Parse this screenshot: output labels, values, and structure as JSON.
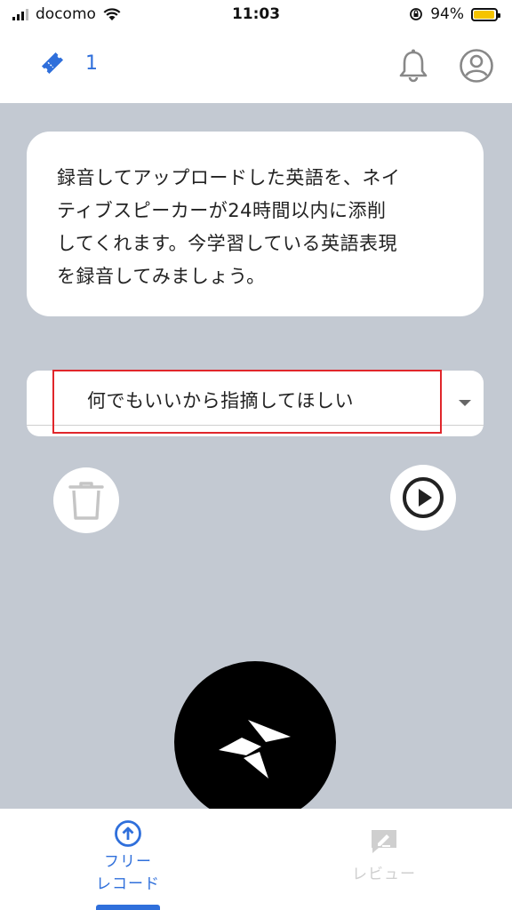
{
  "status_bar": {
    "carrier": "docomo",
    "time": "11:03",
    "battery_percent": "94%",
    "battery_level": 0.94
  },
  "header": {
    "ticket_count": "1",
    "icons": [
      "ticket-icon",
      "bell-icon",
      "account-icon"
    ]
  },
  "info_card": {
    "lines": [
      "録音してアップロードした英語を、ネイ",
      "ティブスピーカーが24時間以内に添削",
      "してくれます。今学習している英語表現",
      "を録音してみましょう。"
    ]
  },
  "feedback_select": {
    "selected": "何でもいいから指摘してほしい"
  },
  "actions": {
    "icons": [
      "trash-icon",
      "play-icon",
      "send-icon"
    ]
  },
  "bottom_nav": {
    "items": [
      {
        "label_line1": "フリー",
        "label_line2": "レコード",
        "active": true
      },
      {
        "label_line1": "レビュー",
        "active": false
      }
    ]
  },
  "colors": {
    "accent": "#2f6fdb",
    "background": "#c3c9d2",
    "highlight": "#e0262b",
    "battery": "#f5c400"
  }
}
